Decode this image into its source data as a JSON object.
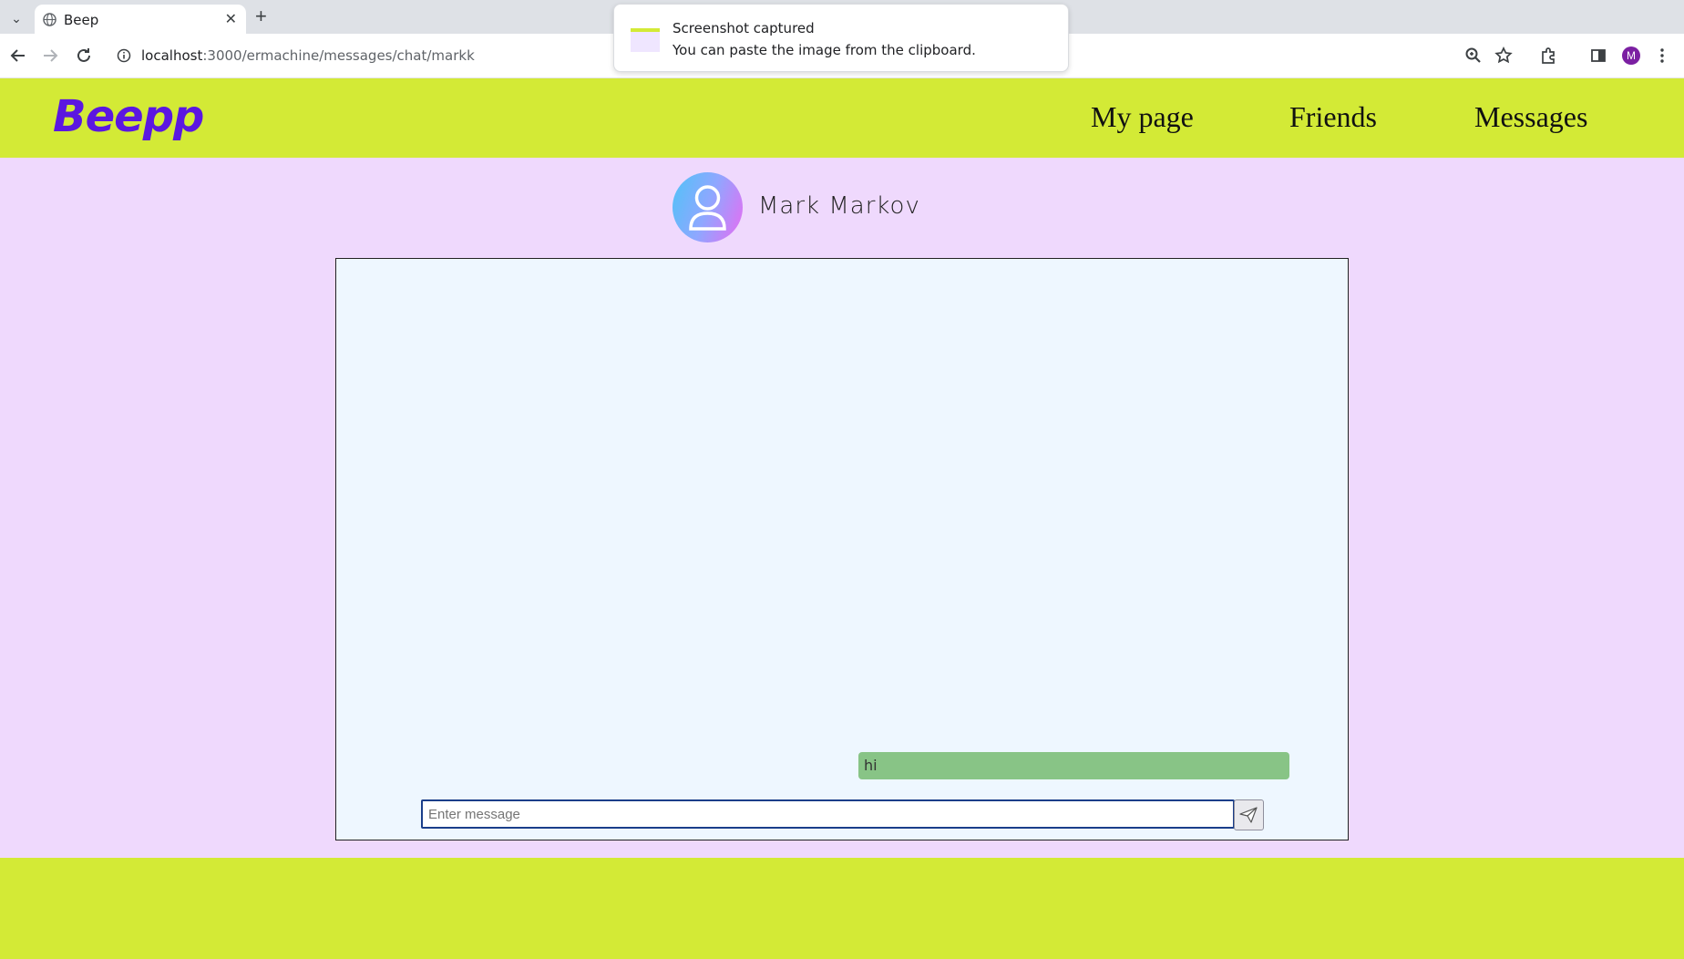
{
  "browser": {
    "tab_title": "Beep",
    "url_host": "localhost",
    "url_path": ":3000/ermachine/messages/chat/markk",
    "profile_initial": "M"
  },
  "toast": {
    "title": "Screenshot captured",
    "message": "You can paste the image from the clipboard."
  },
  "header": {
    "logo": "Beepp",
    "nav": [
      "My page",
      "Friends",
      "Messages"
    ]
  },
  "chat": {
    "contact_name": "Mark Markov",
    "messages": [
      {
        "text": "hi",
        "from": "me"
      }
    ],
    "input_placeholder": "Enter message"
  },
  "colors": {
    "header_bg": "#d3ea36",
    "page_bg": "#efd9fd",
    "logo": "#5b17e0",
    "bubble": "#88c486",
    "chat_bg": "#eef7ff"
  }
}
